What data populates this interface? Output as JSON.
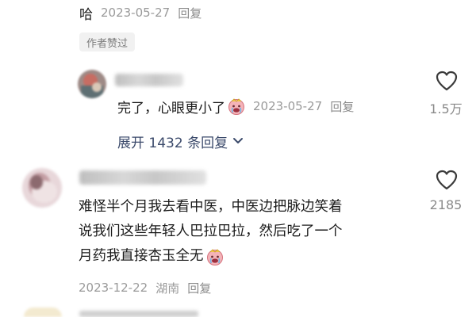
{
  "top_comment": {
    "text_tail": "哈",
    "date": "2023-05-27",
    "reply_label": "回复",
    "badge": "作者赞过"
  },
  "reply_comment": {
    "text": "完了，心眼更小了",
    "emoji": "crying-face",
    "date": "2023-05-27",
    "reply_label": "回复",
    "like_count": "1.5万"
  },
  "expand": {
    "label": "展开 1432 条回复",
    "arrow": "chevron-down-icon"
  },
  "main_comment": {
    "line1": "难怪半个月我去看中医，中医边把脉边笑着",
    "line2": "说我们这些年轻人巴拉巴拉，然后吃了一个",
    "line3": "月药我直接杏玉全无",
    "emoji": "crying-face",
    "date": "2023-12-22",
    "location": "湖南",
    "reply_label": "回复",
    "like_count": "2185"
  },
  "colors": {
    "background": "#ffffff",
    "expand_link": "#3b4a6b",
    "meta_gray": "#9a9a9a",
    "badge_bg": "#f1f1f1"
  }
}
